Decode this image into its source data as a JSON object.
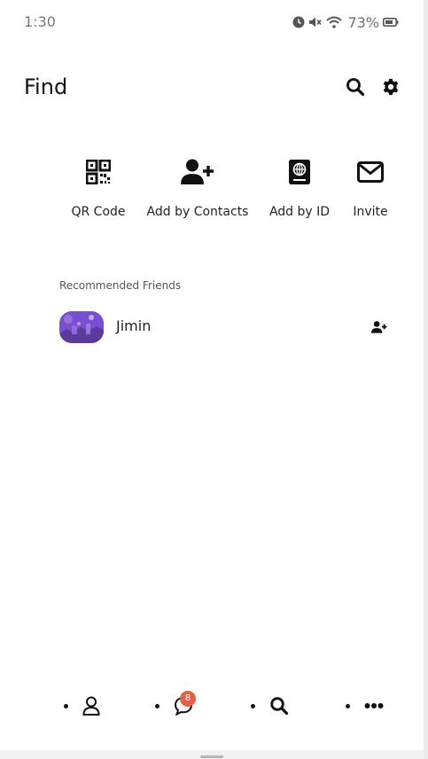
{
  "status_bar": {
    "time": "1:30",
    "battery": "73%",
    "icons": [
      "alarm-icon",
      "mute-icon",
      "wifi-icon",
      "battery-icon"
    ]
  },
  "header": {
    "title": "Find",
    "icons": [
      "search-icon",
      "gear-icon"
    ]
  },
  "actions": [
    {
      "label": "QR Code",
      "icon": "qr-code-icon"
    },
    {
      "label": "Add by Contacts",
      "icon": "add-contact-icon"
    },
    {
      "label": "Add by ID",
      "icon": "id-book-icon"
    },
    {
      "label": "Invite",
      "icon": "envelope-icon"
    }
  ],
  "recommended": {
    "section_title": "Recommended Friends",
    "friends": [
      {
        "name": "Jimin"
      }
    ]
  },
  "bottom_nav": {
    "items": [
      {
        "icon": "person-icon"
      },
      {
        "icon": "chat-icon",
        "badge": "8"
      },
      {
        "icon": "search-icon"
      },
      {
        "icon": "more-icon"
      }
    ]
  },
  "colors": {
    "accent_badge": "#e0604a",
    "text": "#111111",
    "background": "#ffffff"
  }
}
